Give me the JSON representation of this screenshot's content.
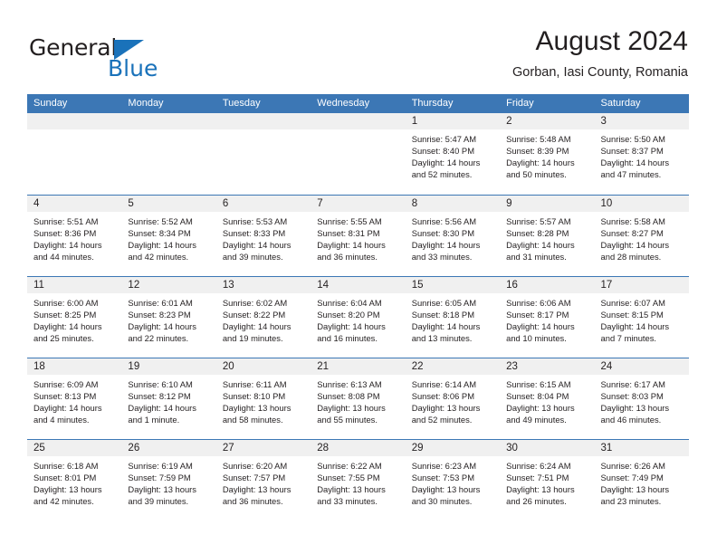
{
  "brand": {
    "name_part1": "General",
    "name_part2": "Blue",
    "logo_icon": "blue-triangle-logo"
  },
  "header": {
    "title": "August 2024",
    "subtitle": "Gorban, Iasi County, Romania"
  },
  "colors": {
    "header_blue": "#3c77b5",
    "brand_blue": "#1a72ba",
    "cell_number_band": "#f0f0f0",
    "text": "#231f20"
  },
  "calendar": {
    "weekday_headers": [
      "Sunday",
      "Monday",
      "Tuesday",
      "Wednesday",
      "Thursday",
      "Friday",
      "Saturday"
    ],
    "weeks": [
      [
        {
          "day": "",
          "lines": []
        },
        {
          "day": "",
          "lines": []
        },
        {
          "day": "",
          "lines": []
        },
        {
          "day": "",
          "lines": []
        },
        {
          "day": "1",
          "lines": [
            "Sunrise: 5:47 AM",
            "Sunset: 8:40 PM",
            "Daylight: 14 hours",
            "and 52 minutes."
          ]
        },
        {
          "day": "2",
          "lines": [
            "Sunrise: 5:48 AM",
            "Sunset: 8:39 PM",
            "Daylight: 14 hours",
            "and 50 minutes."
          ]
        },
        {
          "day": "3",
          "lines": [
            "Sunrise: 5:50 AM",
            "Sunset: 8:37 PM",
            "Daylight: 14 hours",
            "and 47 minutes."
          ]
        }
      ],
      [
        {
          "day": "4",
          "lines": [
            "Sunrise: 5:51 AM",
            "Sunset: 8:36 PM",
            "Daylight: 14 hours",
            "and 44 minutes."
          ]
        },
        {
          "day": "5",
          "lines": [
            "Sunrise: 5:52 AM",
            "Sunset: 8:34 PM",
            "Daylight: 14 hours",
            "and 42 minutes."
          ]
        },
        {
          "day": "6",
          "lines": [
            "Sunrise: 5:53 AM",
            "Sunset: 8:33 PM",
            "Daylight: 14 hours",
            "and 39 minutes."
          ]
        },
        {
          "day": "7",
          "lines": [
            "Sunrise: 5:55 AM",
            "Sunset: 8:31 PM",
            "Daylight: 14 hours",
            "and 36 minutes."
          ]
        },
        {
          "day": "8",
          "lines": [
            "Sunrise: 5:56 AM",
            "Sunset: 8:30 PM",
            "Daylight: 14 hours",
            "and 33 minutes."
          ]
        },
        {
          "day": "9",
          "lines": [
            "Sunrise: 5:57 AM",
            "Sunset: 8:28 PM",
            "Daylight: 14 hours",
            "and 31 minutes."
          ]
        },
        {
          "day": "10",
          "lines": [
            "Sunrise: 5:58 AM",
            "Sunset: 8:27 PM",
            "Daylight: 14 hours",
            "and 28 minutes."
          ]
        }
      ],
      [
        {
          "day": "11",
          "lines": [
            "Sunrise: 6:00 AM",
            "Sunset: 8:25 PM",
            "Daylight: 14 hours",
            "and 25 minutes."
          ]
        },
        {
          "day": "12",
          "lines": [
            "Sunrise: 6:01 AM",
            "Sunset: 8:23 PM",
            "Daylight: 14 hours",
            "and 22 minutes."
          ]
        },
        {
          "day": "13",
          "lines": [
            "Sunrise: 6:02 AM",
            "Sunset: 8:22 PM",
            "Daylight: 14 hours",
            "and 19 minutes."
          ]
        },
        {
          "day": "14",
          "lines": [
            "Sunrise: 6:04 AM",
            "Sunset: 8:20 PM",
            "Daylight: 14 hours",
            "and 16 minutes."
          ]
        },
        {
          "day": "15",
          "lines": [
            "Sunrise: 6:05 AM",
            "Sunset: 8:18 PM",
            "Daylight: 14 hours",
            "and 13 minutes."
          ]
        },
        {
          "day": "16",
          "lines": [
            "Sunrise: 6:06 AM",
            "Sunset: 8:17 PM",
            "Daylight: 14 hours",
            "and 10 minutes."
          ]
        },
        {
          "day": "17",
          "lines": [
            "Sunrise: 6:07 AM",
            "Sunset: 8:15 PM",
            "Daylight: 14 hours",
            "and 7 minutes."
          ]
        }
      ],
      [
        {
          "day": "18",
          "lines": [
            "Sunrise: 6:09 AM",
            "Sunset: 8:13 PM",
            "Daylight: 14 hours",
            "and 4 minutes."
          ]
        },
        {
          "day": "19",
          "lines": [
            "Sunrise: 6:10 AM",
            "Sunset: 8:12 PM",
            "Daylight: 14 hours",
            "and 1 minute."
          ]
        },
        {
          "day": "20",
          "lines": [
            "Sunrise: 6:11 AM",
            "Sunset: 8:10 PM",
            "Daylight: 13 hours",
            "and 58 minutes."
          ]
        },
        {
          "day": "21",
          "lines": [
            "Sunrise: 6:13 AM",
            "Sunset: 8:08 PM",
            "Daylight: 13 hours",
            "and 55 minutes."
          ]
        },
        {
          "day": "22",
          "lines": [
            "Sunrise: 6:14 AM",
            "Sunset: 8:06 PM",
            "Daylight: 13 hours",
            "and 52 minutes."
          ]
        },
        {
          "day": "23",
          "lines": [
            "Sunrise: 6:15 AM",
            "Sunset: 8:04 PM",
            "Daylight: 13 hours",
            "and 49 minutes."
          ]
        },
        {
          "day": "24",
          "lines": [
            "Sunrise: 6:17 AM",
            "Sunset: 8:03 PM",
            "Daylight: 13 hours",
            "and 46 minutes."
          ]
        }
      ],
      [
        {
          "day": "25",
          "lines": [
            "Sunrise: 6:18 AM",
            "Sunset: 8:01 PM",
            "Daylight: 13 hours",
            "and 42 minutes."
          ]
        },
        {
          "day": "26",
          "lines": [
            "Sunrise: 6:19 AM",
            "Sunset: 7:59 PM",
            "Daylight: 13 hours",
            "and 39 minutes."
          ]
        },
        {
          "day": "27",
          "lines": [
            "Sunrise: 6:20 AM",
            "Sunset: 7:57 PM",
            "Daylight: 13 hours",
            "and 36 minutes."
          ]
        },
        {
          "day": "28",
          "lines": [
            "Sunrise: 6:22 AM",
            "Sunset: 7:55 PM",
            "Daylight: 13 hours",
            "and 33 minutes."
          ]
        },
        {
          "day": "29",
          "lines": [
            "Sunrise: 6:23 AM",
            "Sunset: 7:53 PM",
            "Daylight: 13 hours",
            "and 30 minutes."
          ]
        },
        {
          "day": "30",
          "lines": [
            "Sunrise: 6:24 AM",
            "Sunset: 7:51 PM",
            "Daylight: 13 hours",
            "and 26 minutes."
          ]
        },
        {
          "day": "31",
          "lines": [
            "Sunrise: 6:26 AM",
            "Sunset: 7:49 PM",
            "Daylight: 13 hours",
            "and 23 minutes."
          ]
        }
      ]
    ]
  }
}
